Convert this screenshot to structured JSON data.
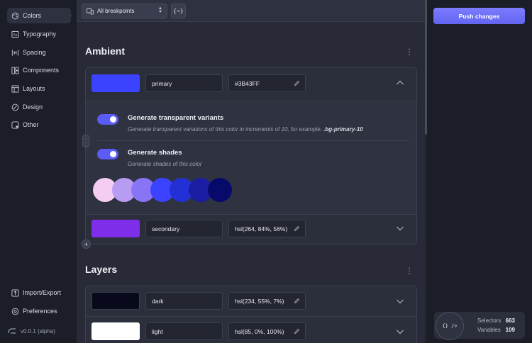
{
  "sidebar": {
    "items": [
      {
        "label": "Colors",
        "icon": "palette-icon",
        "active": true
      },
      {
        "label": "Typography",
        "icon": "typography-icon"
      },
      {
        "label": "Spacing",
        "icon": "spacing-icon"
      },
      {
        "label": "Components",
        "icon": "components-icon"
      },
      {
        "label": "Layouts",
        "icon": "layouts-icon"
      },
      {
        "label": "Design",
        "icon": "design-icon"
      },
      {
        "label": "Other",
        "icon": "other-icon"
      }
    ],
    "bottom_items": [
      {
        "label": "Import/Export",
        "icon": "import-export-icon"
      },
      {
        "label": "Preferences",
        "icon": "preferences-icon"
      }
    ],
    "version": "v0.0.1 (alpha)"
  },
  "toolbar": {
    "breakpoint_select": "All breakpoints",
    "variables_button": "{⋯}"
  },
  "ambient": {
    "title": "Ambient",
    "colors": [
      {
        "name": "primary",
        "value": "#3B43FF",
        "swatch": "#3b43ff",
        "expanded": true
      },
      {
        "name": "secondary",
        "value": "hsl(264, 84%, 56%)",
        "swatch": "#7e2ee9",
        "expanded": false
      }
    ],
    "options": [
      {
        "title": "Generate transparent variants",
        "description": "Generate transparent variations of this color in increments of 10, for example.",
        "example": ".bg-primary-10",
        "enabled": true
      },
      {
        "title": "Generate shades",
        "description": "Generate shades of this color",
        "enabled": true
      }
    ],
    "shades": [
      "#f5cdf2",
      "#b89cf4",
      "#8a74f6",
      "#3b43ff",
      "#2230d6",
      "#1b1ea2",
      "#070a6a"
    ]
  },
  "layers": {
    "title": "Layers",
    "colors": [
      {
        "name": "dark",
        "value": "hsl(234, 55%, 7%)",
        "swatch": "#080a1c"
      },
      {
        "name": "light",
        "value": "hsl(85, 0%, 100%)",
        "swatch": "#ffffff"
      }
    ]
  },
  "right_panel": {
    "push_button": "Push changes",
    "stats": [
      {
        "label": "Selectors",
        "value": "663"
      },
      {
        "label": "Variables",
        "value": "109"
      }
    ],
    "stats_icon_text": "{} />"
  },
  "colors": {
    "accent": "#5b5cf6",
    "background": "#282a37"
  }
}
